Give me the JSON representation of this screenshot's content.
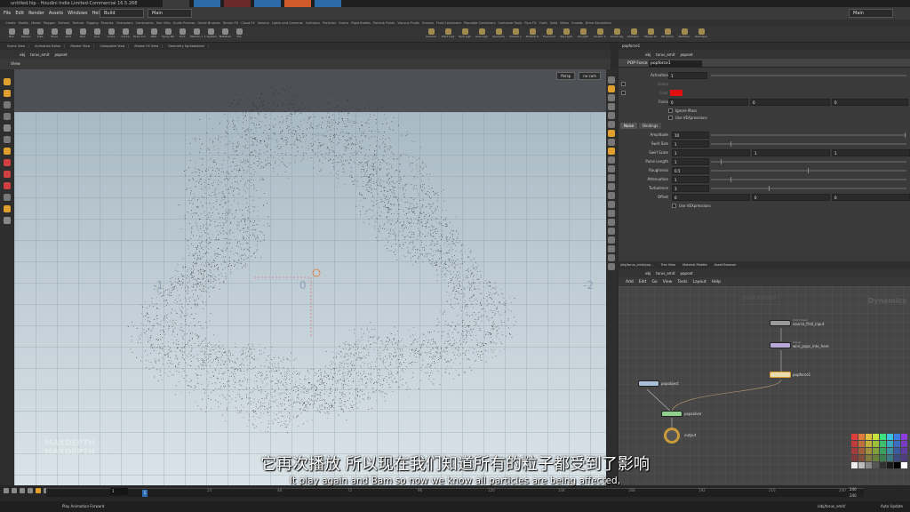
{
  "window": {
    "title": "untitled.hip - Houdini Indie Limited-Commercial 16.5.268"
  },
  "menubar": {
    "items": [
      "File",
      "Edit",
      "Render",
      "Assets",
      "Windows",
      "Help"
    ],
    "build": "Build",
    "main": "Main",
    "desktop": "Main"
  },
  "shelf_tabs": [
    "Create",
    "Modify",
    "Model",
    "Polygon",
    "Deform",
    "Texture",
    "Rigging",
    "Muscles",
    "Characters",
    "Constraints",
    "Hair Utils",
    "Guide Process",
    "Guide Brushes",
    "Terrain FX",
    "Cloud FX",
    "Volume",
    "Lights and Cameras",
    "Collisions",
    "Particles",
    "Grains",
    "Rigid Bodies",
    "Particle Fluids",
    "Viscous Fluids",
    "Oceans",
    "Fluid Containers",
    "Populate Containers",
    "Container Tools",
    "Pyro FX",
    "Cloth",
    "Solid",
    "Wires",
    "Crowds",
    "Drive Simulation"
  ],
  "tools": [
    "Box",
    "Sphere",
    "Tube",
    "Torus",
    "Grid",
    "Null",
    "Line",
    "Circle",
    "Curve",
    "Draw Curve",
    "Path",
    "Spray Paint",
    "Font",
    "Platonic Solids",
    "L-System",
    "Metaball",
    "File"
  ],
  "light_tools": [
    "Camera",
    "Point Light",
    "Spot Light",
    "Area Light",
    "Geometry Light",
    "Volume Light",
    "Distant Light",
    "Environment Light",
    "Sky Light",
    "GI Light",
    "Caustic Light",
    "Portal Light",
    "Ambient Light",
    "Stereo Camera",
    "VR Camera",
    "Switcher",
    "Gamepad Camera"
  ],
  "left_pane": {
    "tabs": [
      "Scene View",
      "Animation Editor",
      "Render View",
      "Composite View",
      "Motion FX View",
      "Geometry Spreadsheet"
    ],
    "path": [
      "obj",
      "torus_emit",
      "popnet"
    ],
    "view_label": "View",
    "persp": "Persp",
    "cam": "no cam"
  },
  "viewport": {
    "axis_left": "-1",
    "axis_mid": "0",
    "axis_right": "-2"
  },
  "params": {
    "tab": "popforce1",
    "path": [
      "obj",
      "torus_emit",
      "popnet"
    ],
    "node_type": "POP Force",
    "node_name": "popforce1",
    "rows": [
      {
        "label": "Activation",
        "value": "1"
      },
      {
        "label": "Group",
        "value": ""
      },
      {
        "label": "Color",
        "value": ""
      },
      {
        "label": "Force",
        "values": [
          "0",
          "0",
          "0"
        ]
      }
    ],
    "checks": [
      "Ignore Mass",
      "Use VEXpressions"
    ],
    "sub_tabs": [
      "Noise",
      "Bindings"
    ],
    "noise": [
      {
        "label": "Amplitude",
        "value": "10",
        "slider": 1.0
      },
      {
        "label": "Swirl Size",
        "value": "1",
        "slider": 0.1
      },
      {
        "label": "Swirl Scale",
        "values": [
          "1",
          "1",
          "1"
        ]
      },
      {
        "label": "Pulse Length",
        "value": "1",
        "slider": 0.05
      },
      {
        "label": "Roughness",
        "value": "0.5",
        "slider": 0.5
      },
      {
        "label": "Attenuation",
        "value": "1",
        "slider": 0.1
      },
      {
        "label": "Turbulence",
        "value": "3",
        "slider": 0.3
      },
      {
        "label": "Offset",
        "values": [
          "0",
          "0",
          "0"
        ]
      }
    ],
    "noise_check": "Use VEXpressions",
    "color_swatch": "#e01010"
  },
  "network": {
    "tabs": [
      "/obj/torus_emit/pop...",
      "Tree View",
      "Material Palette",
      "Asset Browser"
    ],
    "path": [
      "obj",
      "torus_emit",
      "popnet"
    ],
    "menu": [
      "Add",
      "Edit",
      "Go",
      "View",
      "Tools",
      "Layout",
      "Help"
    ],
    "edition": "Indie Edition",
    "context": "Dynamics",
    "nodes": [
      {
        "name": "source_first_input",
        "type": "DOP Object"
      },
      {
        "name": "wire_pops_into_here",
        "type": "Merge"
      },
      {
        "name": "popforce1",
        "type": ""
      },
      {
        "name": "popobject",
        "type": ""
      },
      {
        "name": "popsolver",
        "type": ""
      },
      {
        "name": "output",
        "type": ""
      }
    ]
  },
  "timeline": {
    "frame": "1",
    "start": "1",
    "end": "240",
    "end2": "240",
    "ticks": [
      "24",
      "48",
      "72",
      "96",
      "120",
      "144",
      "168",
      "192",
      "216",
      "240"
    ],
    "field": "1",
    "tip": "Play Animation Forward",
    "object_path": "/obj/torus_emit/",
    "auto_update": "Auto Update"
  },
  "subtitles": {
    "zh": "它再次播放 所以现在我们知道所有的粒子都受到了影响",
    "en": "It play again and Bam so now we know all particles are being affected,"
  },
  "watermark": "MAXDEPTH",
  "palette": [
    "#e03c3c",
    "#e07c3c",
    "#e0c03c",
    "#c8e03c",
    "#3ce07c",
    "#3cc0e0",
    "#3c7ce0",
    "#8c3ce0",
    "#c03c3c",
    "#c0703c",
    "#c0b03c",
    "#9cc03c",
    "#3cc070",
    "#3ca8c0",
    "#3c6cc0",
    "#783cc0",
    "#a03c3c",
    "#a0603c",
    "#a0903c",
    "#80a03c",
    "#3ca060",
    "#3c90a0",
    "#3c5ca0",
    "#603ca0",
    "#803c3c",
    "#80503c",
    "#80783c",
    "#68803c",
    "#3c8050",
    "#3c7880",
    "#3c4c80",
    "#503c80",
    "#eeeeee",
    "#bbbbbb",
    "#888888",
    "#555555",
    "#333333",
    "#1a1a1a",
    "#000000",
    "#ffffff"
  ]
}
